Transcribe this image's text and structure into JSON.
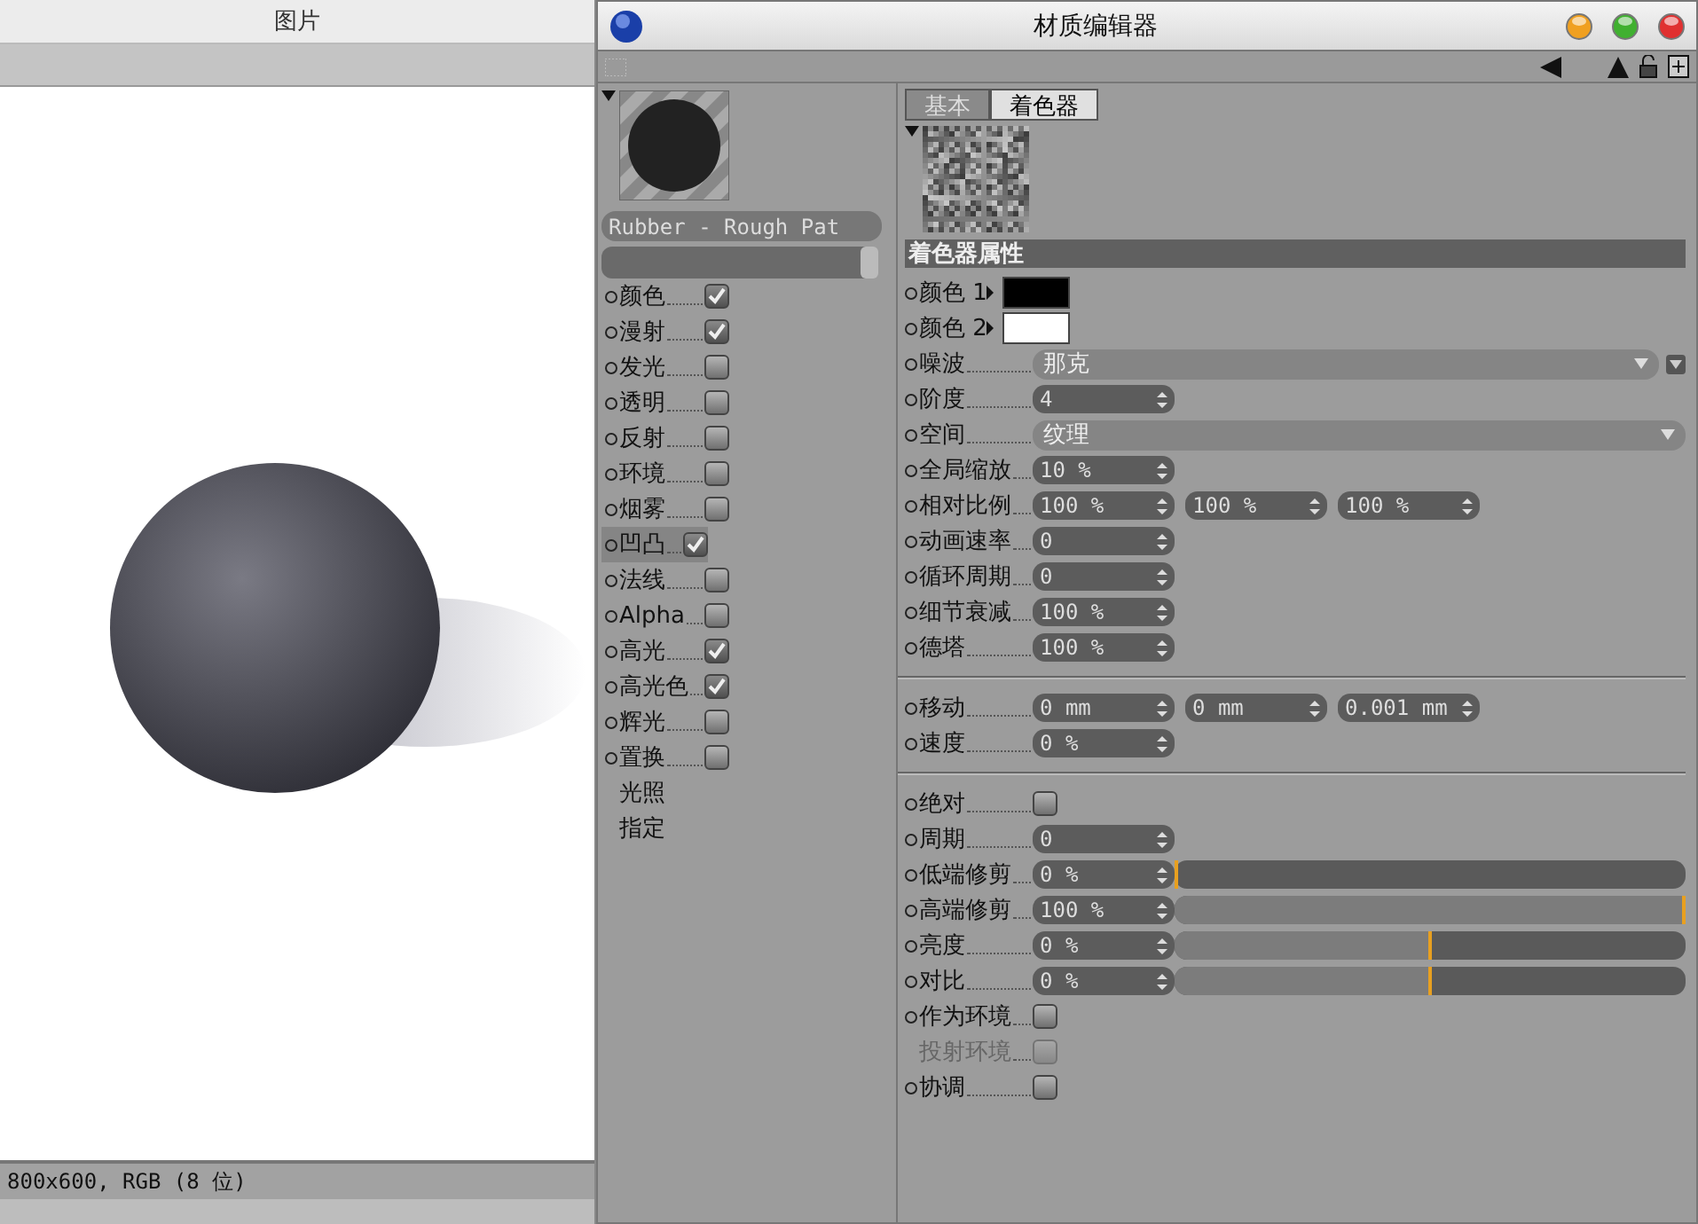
{
  "picture_window": {
    "title": "图片",
    "status_bar": "800x600, RGB (8 位)"
  },
  "editor": {
    "title": "材质编辑器",
    "material_name": "Rubber - Rough Pat",
    "channels": [
      {
        "kind": "channel",
        "label": "颜色",
        "checked": true,
        "selected": false
      },
      {
        "kind": "channel",
        "label": "漫射",
        "checked": true,
        "selected": false
      },
      {
        "kind": "channel",
        "label": "发光",
        "checked": false,
        "selected": false
      },
      {
        "kind": "channel",
        "label": "透明",
        "checked": false,
        "selected": false
      },
      {
        "kind": "channel",
        "label": "反射",
        "checked": false,
        "selected": false
      },
      {
        "kind": "channel",
        "label": "环境",
        "checked": false,
        "selected": false
      },
      {
        "kind": "channel",
        "label": "烟雾",
        "checked": false,
        "selected": false
      },
      {
        "kind": "channel",
        "label": "凹凸",
        "checked": true,
        "selected": true
      },
      {
        "kind": "channel",
        "label": "法线",
        "checked": false,
        "selected": false
      },
      {
        "kind": "channel",
        "label": "Alpha",
        "checked": false,
        "selected": false
      },
      {
        "kind": "channel",
        "label": "高光",
        "checked": true,
        "selected": false
      },
      {
        "kind": "channel",
        "label": "高光色",
        "checked": true,
        "selected": false
      },
      {
        "kind": "channel",
        "label": "辉光",
        "checked": false,
        "selected": false
      },
      {
        "kind": "channel",
        "label": "置换",
        "checked": false,
        "selected": false
      },
      {
        "kind": "link",
        "label": "光照",
        "selected": false
      },
      {
        "kind": "link",
        "label": "指定",
        "selected": false
      }
    ],
    "tabs": [
      {
        "label": "基本",
        "selected": false
      },
      {
        "label": "着色器",
        "selected": true
      }
    ],
    "section_title": "着色器属性",
    "params": [
      {
        "kind": "color",
        "label": "颜色 1",
        "color": "#000000"
      },
      {
        "kind": "color",
        "label": "颜色 2",
        "color": "#ffffff"
      },
      {
        "kind": "dropdown",
        "label": "噪波",
        "value": "那克",
        "menu": true
      },
      {
        "kind": "number",
        "label": "阶度",
        "value": "4"
      },
      {
        "kind": "dropdown",
        "label": "空间",
        "value": "纹理",
        "menu": false
      },
      {
        "kind": "number",
        "label": "全局缩放",
        "value": "10 %"
      },
      {
        "kind": "numbers",
        "label": "相对比例",
        "values": [
          "100 %",
          "100 %",
          "100 %"
        ]
      },
      {
        "kind": "number",
        "label": "动画速率",
        "value": "0"
      },
      {
        "kind": "number",
        "label": "循环周期",
        "value": "0"
      },
      {
        "kind": "number",
        "label": "细节衰减",
        "value": "100 %"
      },
      {
        "kind": "number",
        "label": "德塔",
        "value": "100 %"
      },
      {
        "kind": "separator"
      },
      {
        "kind": "numbers",
        "label": "移动",
        "values": [
          "0 mm",
          "0 mm",
          "0.001 mm"
        ]
      },
      {
        "kind": "number",
        "label": "速度",
        "value": "0 %"
      },
      {
        "kind": "separator"
      },
      {
        "kind": "checkbox",
        "label": "绝对",
        "checked": false,
        "disabled": false
      },
      {
        "kind": "number",
        "label": "周期",
        "value": "0"
      },
      {
        "kind": "slider",
        "label": "低端修剪",
        "value": "0 %",
        "level": 0
      },
      {
        "kind": "slider",
        "label": "高端修剪",
        "value": "100 %",
        "level": 1
      },
      {
        "kind": "slider",
        "label": "亮度",
        "value": "0 %",
        "level": 0.5
      },
      {
        "kind": "slider",
        "label": "对比",
        "value": "0 %",
        "level": 0.5
      },
      {
        "kind": "checkbox",
        "label": "作为环境",
        "checked": false,
        "disabled": false
      },
      {
        "kind": "checkbox",
        "label": "投射环境",
        "checked": false,
        "disabled": true
      },
      {
        "kind": "checkbox",
        "label": "协调",
        "checked": false,
        "disabled": false
      }
    ]
  }
}
